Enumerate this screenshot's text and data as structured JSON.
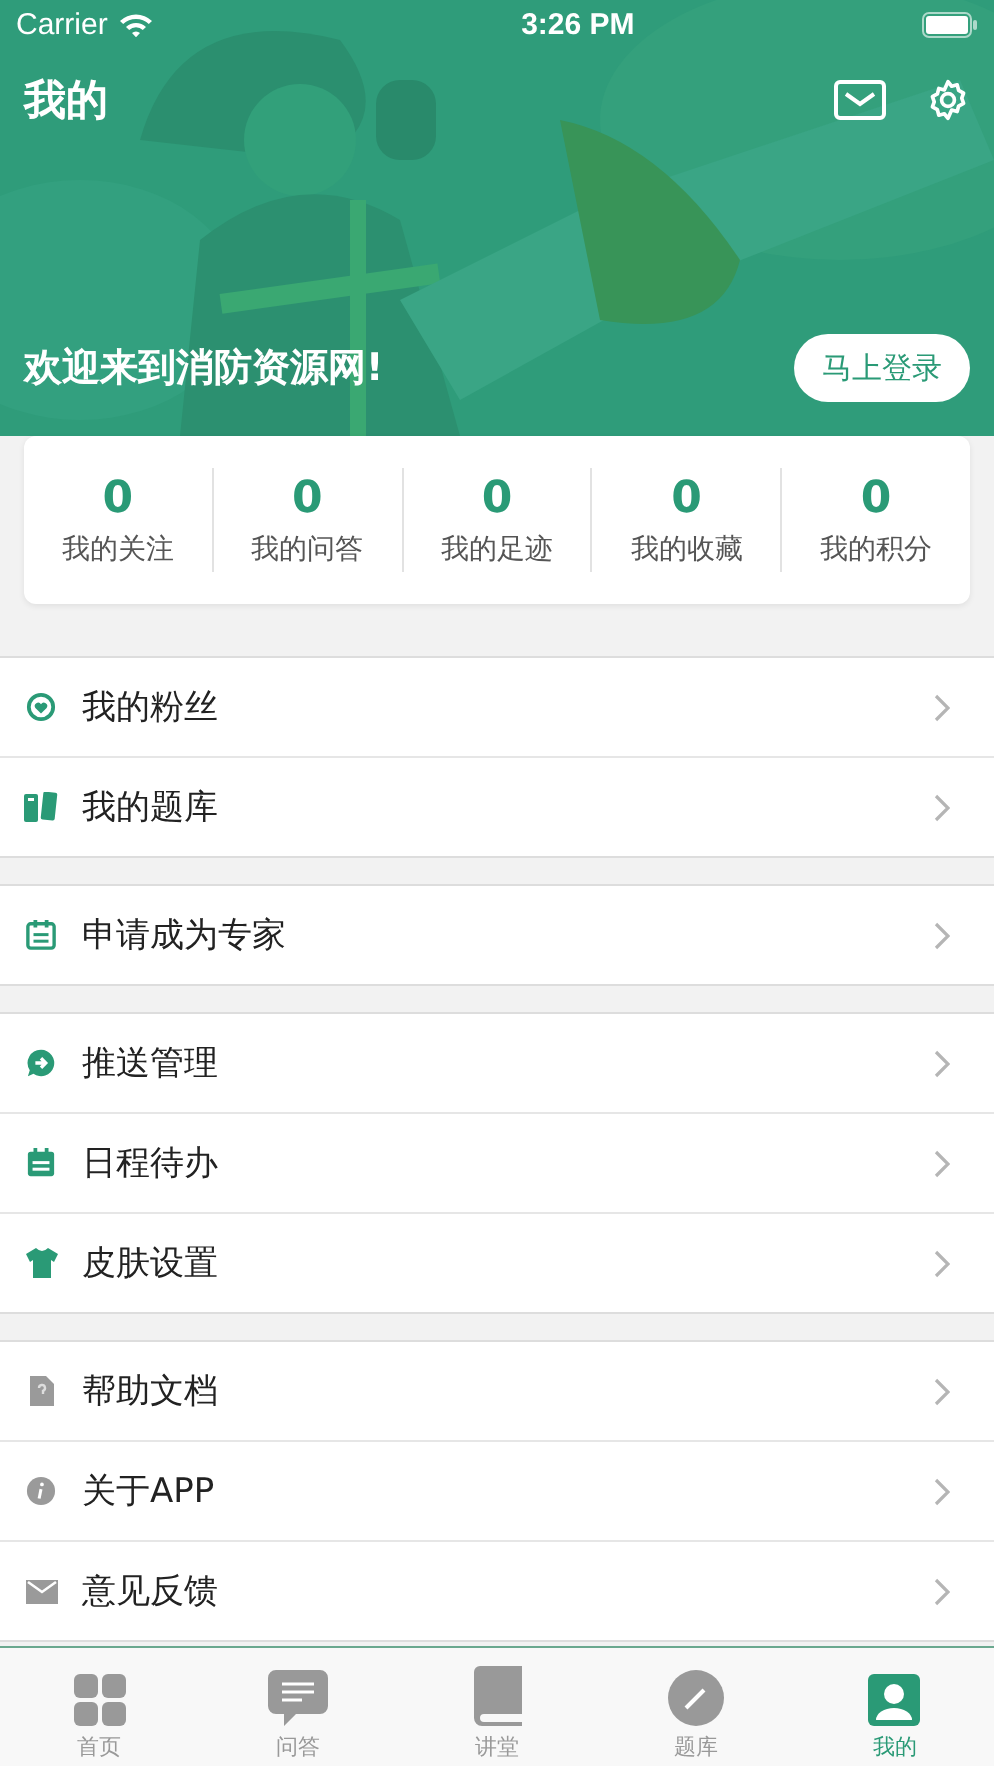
{
  "status_bar": {
    "carrier": "Carrier",
    "time": "3:26 PM"
  },
  "header": {
    "title": "我的",
    "welcome": "欢迎来到消防资源网!",
    "login_button": "马上登录"
  },
  "stats": [
    {
      "value": "0",
      "label": "我的关注"
    },
    {
      "value": "0",
      "label": "我的问答"
    },
    {
      "value": "0",
      "label": "我的足迹"
    },
    {
      "value": "0",
      "label": "我的收藏"
    },
    {
      "value": "0",
      "label": "我的积分"
    }
  ],
  "menu_groups": [
    [
      {
        "kind": "heart",
        "label": "我的粉丝"
      },
      {
        "kind": "books",
        "label": "我的题库"
      }
    ],
    [
      {
        "kind": "calendar",
        "label": "申请成为专家"
      }
    ],
    [
      {
        "kind": "push",
        "label": "推送管理"
      },
      {
        "kind": "schedule",
        "label": "日程待办"
      },
      {
        "kind": "shirt",
        "label": "皮肤设置"
      }
    ],
    [
      {
        "kind": "doc",
        "label": "帮助文档"
      },
      {
        "kind": "info",
        "label": "关于APP"
      },
      {
        "kind": "mail",
        "label": "意见反馈"
      }
    ]
  ],
  "tabs": [
    {
      "kind": "grid",
      "label": "首页",
      "selected": false
    },
    {
      "kind": "chat",
      "label": "问答",
      "selected": false
    },
    {
      "kind": "book",
      "label": "讲堂",
      "selected": false
    },
    {
      "kind": "pencil",
      "label": "题库",
      "selected": false
    },
    {
      "kind": "person",
      "label": "我的",
      "selected": true
    }
  ]
}
